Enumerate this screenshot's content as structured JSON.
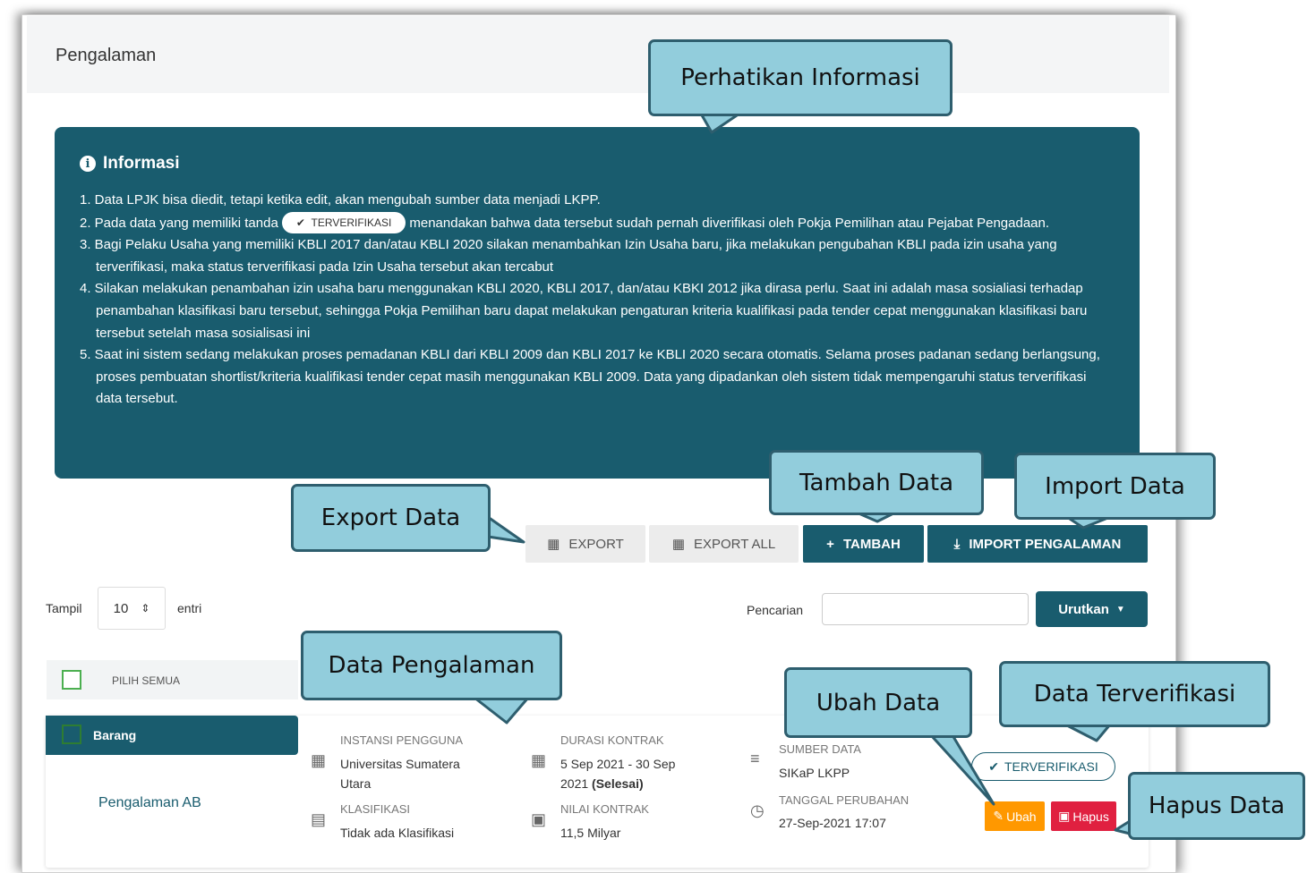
{
  "header": {
    "title": "Pengalaman"
  },
  "info": {
    "title": "Informasi",
    "items": [
      "1. Data LPJK bisa diedit, tetapi ketika edit, akan mengubah sumber data menjadi LKPP.",
      "2. Pada data yang memiliki tanda",
      "menandakan bahwa data tersebut sudah pernah diverifikasi oleh Pokja Pemilihan atau Pejabat Pengadaan.",
      "3. Bagi Pelaku Usaha yang memiliki KBLI 2017 dan/atau KBLI 2020 silakan menambahkan Izin Usaha baru, jika melakukan pengubahan KBLI pada izin usaha yang terverifikasi, maka status terverifikasi pada Izin Usaha tersebut akan tercabut",
      "4. Silakan melakukan penambahan izin usaha baru menggunakan KBLI 2020, KBLI 2017, dan/atau KBKI 2012 jika dirasa perlu. Saat ini adalah masa sosialiasi terhadap penambahan klasifikasi baru tersebut, sehingga Pokja Pemilihan baru dapat melakukan pengaturan kriteria kualifikasi pada tender cepat menggunakan klasifikasi baru tersebut setelah masa sosialisasi ini",
      "5. Saat ini sistem sedang melakukan proses pemadanan KBLI dari KBLI 2009 dan KBLI 2017 ke KBLI 2020 secara otomatis. Selama proses padanan sedang berlangsung, proses pembuatan shortlist/kriteria kualifikasi tender cepat masih menggunakan KBLI 2009. Data yang dipadankan oleh sistem tidak mempengaruhi status terverifikasi data tersebut."
    ],
    "badge": "TERVERIFIKASI"
  },
  "toolbar": {
    "export": "EXPORT",
    "export_all": "EXPORT ALL",
    "tambah": "TAMBAH",
    "import": "IMPORT PENGALAMAN"
  },
  "list_controls": {
    "show_label": "Tampil",
    "page_size": "10",
    "entries_label": "entri",
    "search_label": "Pencarian",
    "sort_label": "Urutkan",
    "select_all": "PILIH SEMUA"
  },
  "record": {
    "category": "Barang",
    "title": "Pengalaman AB",
    "instansi_label": "INSTANSI PENGGUNA",
    "instansi_value_1": "Universitas Sumatera",
    "instansi_value_2": "Utara",
    "klasifikasi_label": "KLASIFIKASI",
    "klasifikasi_value": "Tidak ada Klasifikasi",
    "durasi_label": "DURASI KONTRAK",
    "durasi_value_1": "5 Sep 2021 - 30 Sep",
    "durasi_value_2": "2021",
    "durasi_status": "(Selesai)",
    "nilai_label": "NILAI KONTRAK",
    "nilai_value": "11,5 Milyar",
    "sumber_label": "SUMBER DATA",
    "sumber_value": "SIKaP LKPP",
    "tanggal_label": "TANGGAL PERUBAHAN",
    "tanggal_value": "27-Sep-2021 17:07",
    "status": "TERVERIFIKASI",
    "ubah": "Ubah",
    "hapus": "Hapus"
  },
  "callouts": {
    "perhatikan": "Perhatikan Informasi",
    "tambah": "Tambah Data",
    "import": "Import Data",
    "export": "Export Data",
    "data_pengalaman": "Data Pengalaman",
    "ubah": "Ubah Data",
    "terverifikasi": "Data Terverifikasi",
    "hapus": "Hapus Data"
  },
  "colors": {
    "primary": "#195c6e",
    "callout": "#92cddc",
    "warning": "#ff9800",
    "danger": "#e02040",
    "check": "#4caf50"
  }
}
